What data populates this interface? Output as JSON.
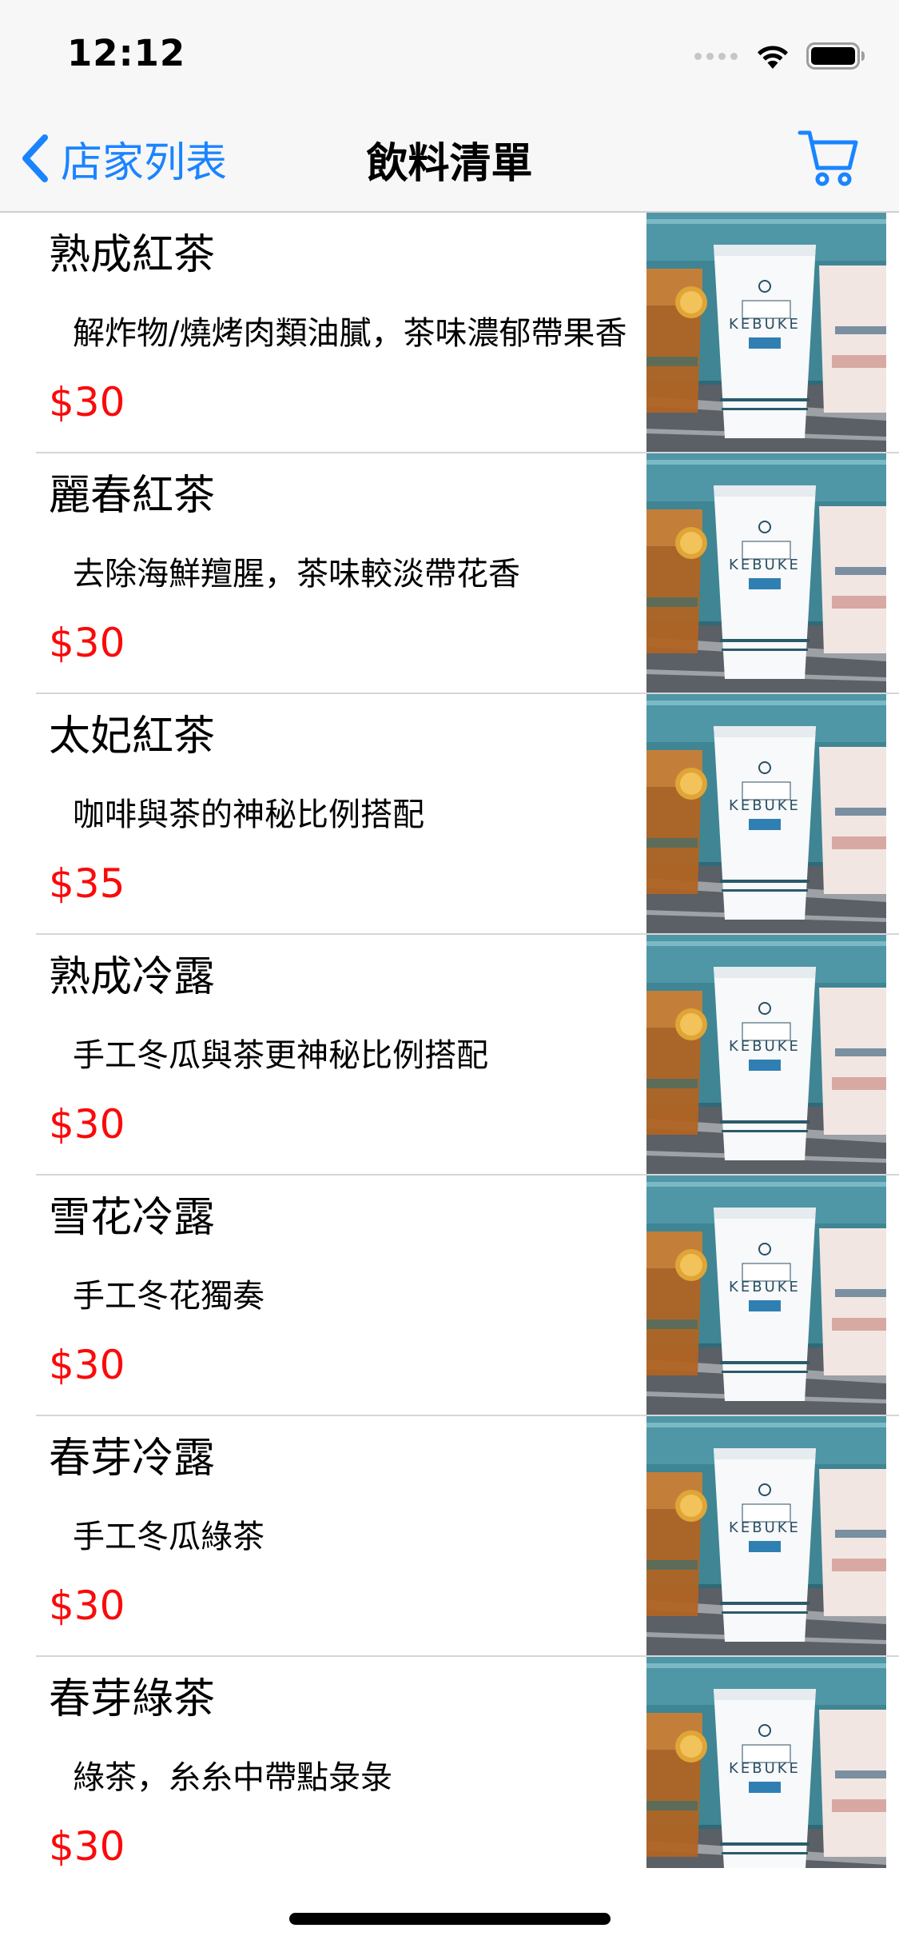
{
  "status_bar": {
    "time": "12:12"
  },
  "nav": {
    "back_label": "店家列表",
    "title": "飲料清單"
  },
  "drinks": [
    {
      "name": "熟成紅茶",
      "description": "解炸物/燒烤肉類油膩，茶味濃郁帶果香",
      "price": "$30"
    },
    {
      "name": "麗春紅茶",
      "description": "去除海鮮羶腥，茶味較淡帶花香",
      "price": "$30"
    },
    {
      "name": "太妃紅茶",
      "description": "咖啡與茶的神秘比例搭配",
      "price": "$35"
    },
    {
      "name": "熟成冷露",
      "description": "手工冬瓜與茶更神秘比例搭配",
      "price": "$30"
    },
    {
      "name": "雪花冷露",
      "description": "手工冬花獨奏",
      "price": "$30"
    },
    {
      "name": "春芽冷露",
      "description": "手工冬瓜綠茶",
      "price": "$30"
    },
    {
      "name": "春芽綠茶",
      "description": "綠茶，糸糸中帶點彔彔",
      "price": "$30"
    }
  ],
  "product_image": {
    "brand_text": "KEBUKE"
  },
  "colors": {
    "accent": "#1a84ff",
    "price": "#fa0a0a",
    "bar_background": "#f7f7f7",
    "separator": "#d6d6d8"
  }
}
